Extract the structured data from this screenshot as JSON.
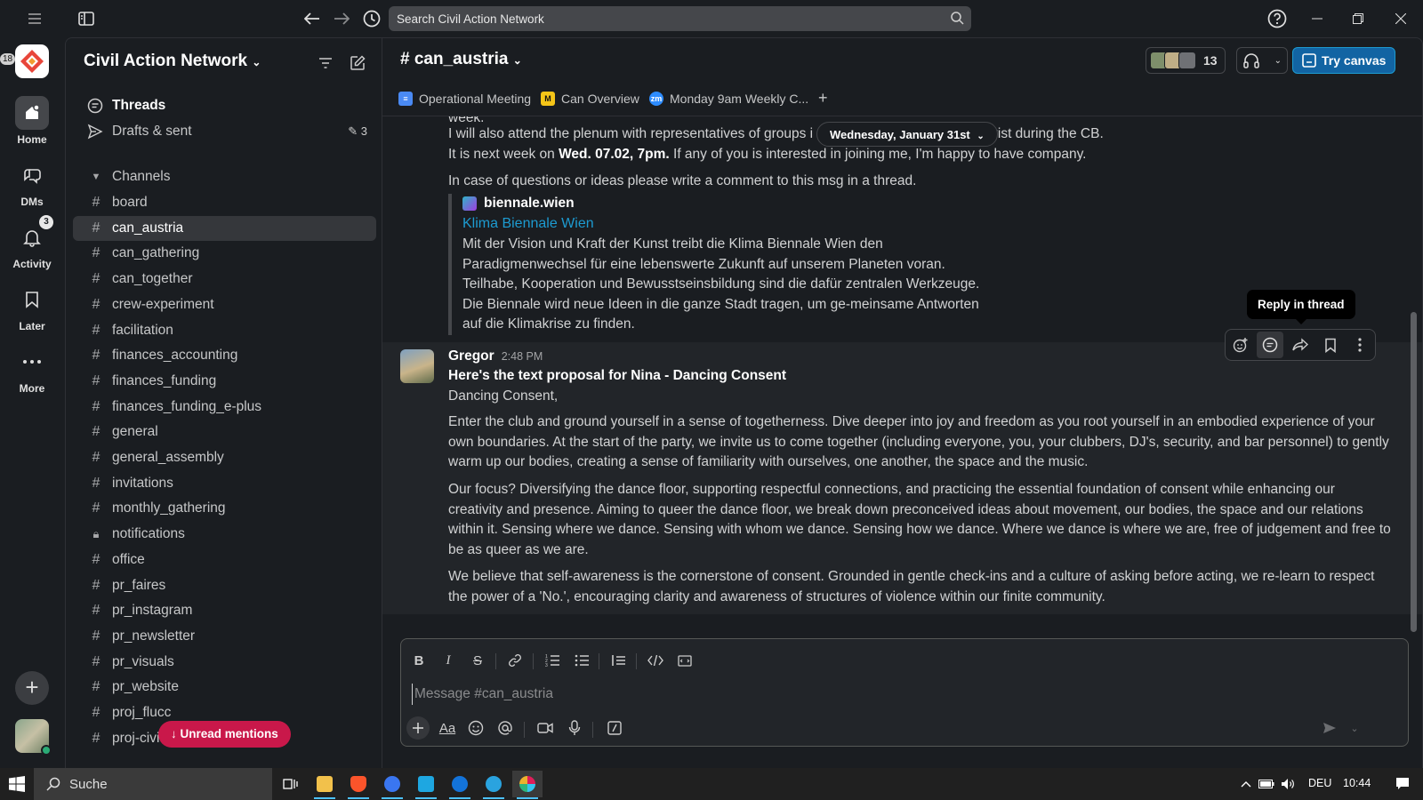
{
  "top": {
    "search_placeholder": "Search Civil Action Network"
  },
  "rail": {
    "workspace_badge": "18",
    "items": [
      {
        "label": "Home"
      },
      {
        "label": "DMs"
      },
      {
        "label": "Activity",
        "badge": "3"
      },
      {
        "label": "Later"
      },
      {
        "label": "More"
      }
    ]
  },
  "sidebar": {
    "workspace": "Civil Action Network",
    "threads": "Threads",
    "drafts": "Drafts & sent",
    "drafts_count": "3",
    "channels_header": "Channels",
    "channels": [
      {
        "name": "board",
        "type": "hash"
      },
      {
        "name": "can_austria",
        "type": "hash",
        "active": true
      },
      {
        "name": "can_gathering",
        "type": "hash"
      },
      {
        "name": "can_together",
        "type": "hash"
      },
      {
        "name": "crew-experiment",
        "type": "hash"
      },
      {
        "name": "facilitation",
        "type": "hash"
      },
      {
        "name": "finances_accounting",
        "type": "hash"
      },
      {
        "name": "finances_funding",
        "type": "hash"
      },
      {
        "name": "finances_funding_e-plus",
        "type": "hash"
      },
      {
        "name": "general",
        "type": "hash"
      },
      {
        "name": "general_assembly",
        "type": "hash"
      },
      {
        "name": "invitations",
        "type": "hash"
      },
      {
        "name": "monthly_gathering",
        "type": "hash"
      },
      {
        "name": "notifications",
        "type": "lock"
      },
      {
        "name": "office",
        "type": "hash"
      },
      {
        "name": "pr_faires",
        "type": "hash"
      },
      {
        "name": "pr_instagram",
        "type": "hash"
      },
      {
        "name": "pr_newsletter",
        "type": "hash"
      },
      {
        "name": "pr_visuals",
        "type": "hash"
      },
      {
        "name": "pr_website",
        "type": "hash"
      },
      {
        "name": "proj_flucc",
        "type": "hash"
      },
      {
        "name": "proj-civi",
        "type": "hash"
      }
    ],
    "unread_mentions": "Unread mentions"
  },
  "channel": {
    "title": "# can_austria",
    "member_count": "13",
    "try_canvas": "Try canvas",
    "tabs": [
      {
        "label": "Operational Meeting"
      },
      {
        "label": "Can Overview"
      },
      {
        "label": "Monday 9am Weekly C..."
      }
    ],
    "date_divider": "Wednesday, January 31st"
  },
  "messages": {
    "prev": {
      "line0": "week.",
      "line1a": "I will also attend the plenum with representatives of groups i",
      "line1b": "activist during the CB.",
      "line2_pre": "It is next week on ",
      "line2_bold": "Wed. 07.02, 7pm.",
      "line2_post": " If any of you is interested in joining me, I'm happy to have company.",
      "line3": "In case of questions or ideas please write a comment to this msg in a thread.",
      "unfurl_site": "biennale.wien",
      "unfurl_title": "Klima Biennale Wien",
      "unfurl_body": [
        "Mit der Vision und Kraft der Kunst treibt die Klima Biennale Wien den",
        "Paradigmenwechsel für eine lebenswerte Zukunft auf unserem Planeten voran.",
        "Teilhabe, Kooperation und Bewusstseinsbildung sind die dafür zentralen Werkzeuge.",
        "Die Biennale wird neue Ideen in die ganze Stadt tragen, um ge-meinsame Antworten",
        "auf die Klimakrise zu finden."
      ]
    },
    "gregor": {
      "author": "Gregor",
      "time": "2:48 PM",
      "heading": "Here's the text proposal for Nina - Dancing Consent",
      "greeting": "Dancing Consent,",
      "p1": "Enter the club and ground yourself in a sense of togetherness. Dive deeper into joy and freedom as you root yourself in an embodied experience of your own boundaries. At the start of the party, we invite us to come together (including everyone, you, your clubbers, DJ's, security, and bar personnel) to gently warm up our bodies, creating a sense of familiarity with ourselves, one another, the space and the music.",
      "p2": "Our focus? Diversifying the dance floor, supporting respectful connections, and practicing the essential foundation of consent while enhancing our creativity and presence. Aiming to queer the dance floor, we break down preconceived ideas about movement, our bodies, the space and our relations within it. Sensing where we dance. Sensing with whom we dance. Sensing how we dance. Where we dance is where we are, free of judgement and free to be as queer as we are.",
      "p3": "We believe that self-awareness is the cornerstone of consent. Grounded in gentle check-ins and a culture of asking before acting, we re-learn to respect the power of a 'No.', encouraging clarity and awareness of structures of violence within our finite community."
    },
    "tooltip": "Reply in thread"
  },
  "composer": {
    "placeholder": "Message #can_austria"
  },
  "taskbar": {
    "search": "Suche",
    "lang": "DEU",
    "time": "10:44"
  }
}
